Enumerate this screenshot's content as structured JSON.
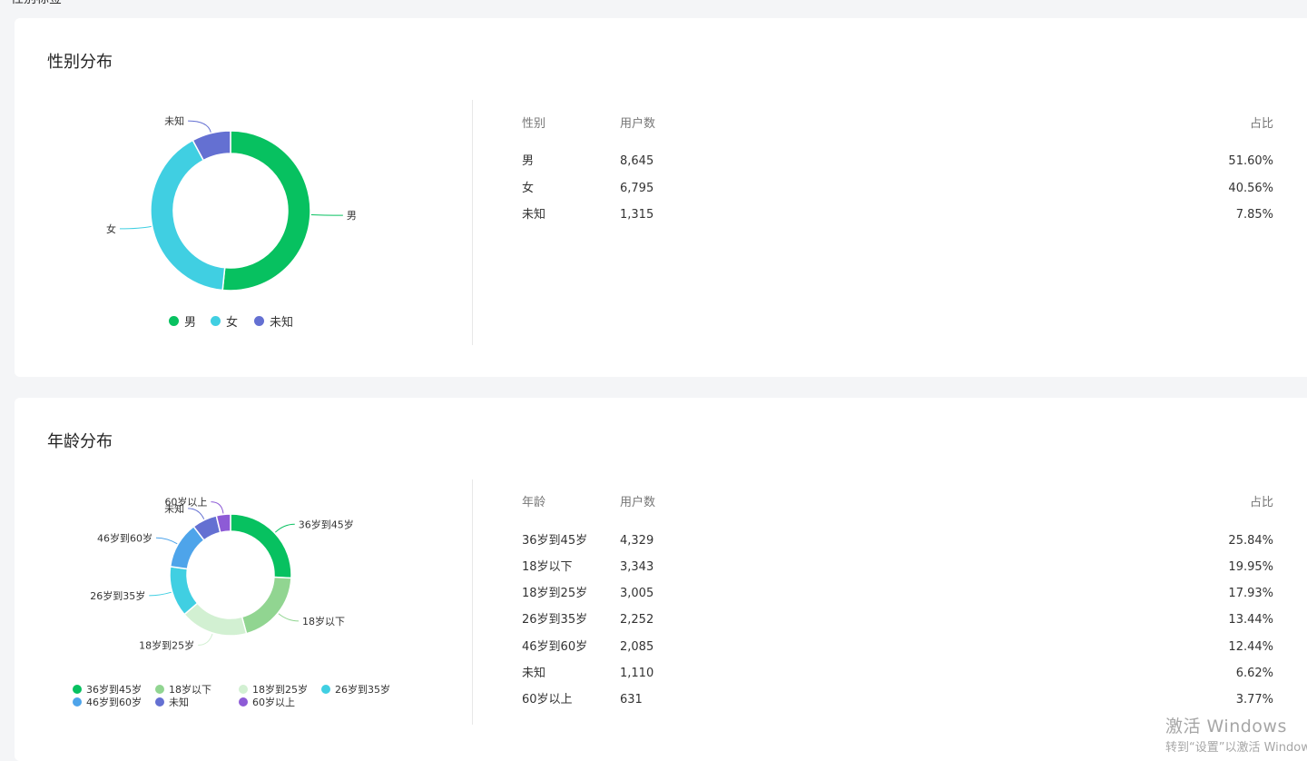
{
  "page_clip_text": "性别标签",
  "colors": {
    "green": "#07c160",
    "light_green": "#91d591",
    "pale_green": "#d2f0d2",
    "cyan": "#40cfe2",
    "blue": "#4ea4ea",
    "indigo": "#6470d2",
    "purple": "#8d5bd6",
    "unknown_gender": "#6470d2"
  },
  "gender": {
    "title": "性别分布",
    "table": {
      "headers": [
        "性别",
        "用户数",
        "占比"
      ],
      "rows": [
        {
          "label": "男",
          "count": "8,645",
          "pct": "51.60%"
        },
        {
          "label": "女",
          "count": "6,795",
          "pct": "40.56%"
        },
        {
          "label": "未知",
          "count": "1,315",
          "pct": "7.85%"
        }
      ]
    },
    "legend": [
      "男",
      "女",
      "未知"
    ]
  },
  "age": {
    "title": "年龄分布",
    "table": {
      "headers": [
        "年龄",
        "用户数",
        "占比"
      ],
      "rows": [
        {
          "label": "36岁到45岁",
          "count": "4,329",
          "pct": "25.84%"
        },
        {
          "label": "18岁以下",
          "count": "3,343",
          "pct": "19.95%"
        },
        {
          "label": "18岁到25岁",
          "count": "3,005",
          "pct": "17.93%"
        },
        {
          "label": "26岁到35岁",
          "count": "2,252",
          "pct": "13.44%"
        },
        {
          "label": "46岁到60岁",
          "count": "2,085",
          "pct": "12.44%"
        },
        {
          "label": "未知",
          "count": "1,110",
          "pct": "6.62%"
        },
        {
          "label": "60岁以上",
          "count": "631",
          "pct": "3.77%"
        }
      ]
    },
    "legend": [
      "36岁到45岁",
      "18岁以下",
      "18岁到25岁",
      "26岁到35岁",
      "46岁到60岁",
      "未知",
      "60岁以上"
    ]
  },
  "chart_data": [
    {
      "type": "pie",
      "categories": [
        "男",
        "女",
        "未知"
      ],
      "values": [
        8645,
        6795,
        1315
      ],
      "colors": [
        "#07c160",
        "#40cfe2",
        "#6470d2"
      ],
      "legend": "bottom"
    },
    {
      "type": "pie",
      "categories": [
        "36岁到45岁",
        "18岁以下",
        "18岁到25岁",
        "26岁到35岁",
        "46岁到60岁",
        "未知",
        "60岁以上"
      ],
      "values": [
        4329,
        3343,
        3005,
        2252,
        2085,
        1110,
        631
      ],
      "colors": [
        "#07c160",
        "#91d591",
        "#d2f0d2",
        "#40cfe2",
        "#4ea4ea",
        "#6470d2",
        "#8d5bd6"
      ],
      "legend": "bottom"
    }
  ],
  "watermark": {
    "line1": "激活 Windows",
    "line2": "转到“设置”以激活 Windows"
  }
}
